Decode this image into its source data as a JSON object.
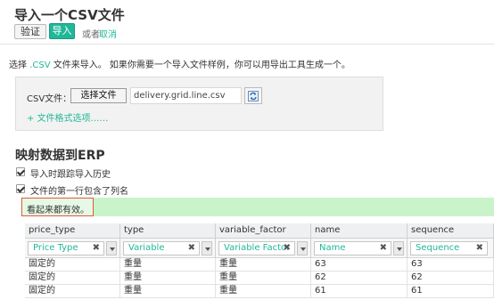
{
  "header": {
    "title": "导入一个CSV文件",
    "verify_label": "验证",
    "import_label": "导入",
    "or_text": "或者",
    "cancel_label": "取消"
  },
  "intro": {
    "prefix": "选择",
    "csv_link": ".CSV",
    "suffix": "文件来导入。 如果你需要一个导入文件样例，你可以用导出工具生成一个。"
  },
  "file_panel": {
    "label": "CSV文件：",
    "choose_button": "选择文件",
    "file_name": "delivery.grid.line.csv",
    "options_link": "+ 文件格式选项……"
  },
  "mapping": {
    "title": "映射数据到ERP",
    "track_history_label": "导入时跟踪导入历史",
    "first_row_header_label": "文件的第一行包含了列名",
    "success_message": "看起来都有效。"
  },
  "grid": {
    "columns": [
      {
        "header": "price_type",
        "field": "Price Type"
      },
      {
        "header": "type",
        "field": "Variable"
      },
      {
        "header": "variable_factor",
        "field": "Variable Factor"
      },
      {
        "header": "name",
        "field": "Name"
      },
      {
        "header": "sequence",
        "field": "Sequence"
      }
    ],
    "rows": [
      [
        "固定的",
        "重量",
        "重量",
        "63",
        "63"
      ],
      [
        "固定的",
        "重量",
        "重量",
        "62",
        "62"
      ],
      [
        "固定的",
        "重量",
        "重量",
        "61",
        "61"
      ]
    ]
  },
  "colors": {
    "accent": "#21b799",
    "success_bg": "#c9f3c9",
    "highlight_border": "#e05a3a"
  },
  "icons": {
    "reload": "reload-icon",
    "clear": "clear-icon",
    "dropdown": "chevron-down-icon",
    "checkbox": "checkbox-checked-icon"
  }
}
